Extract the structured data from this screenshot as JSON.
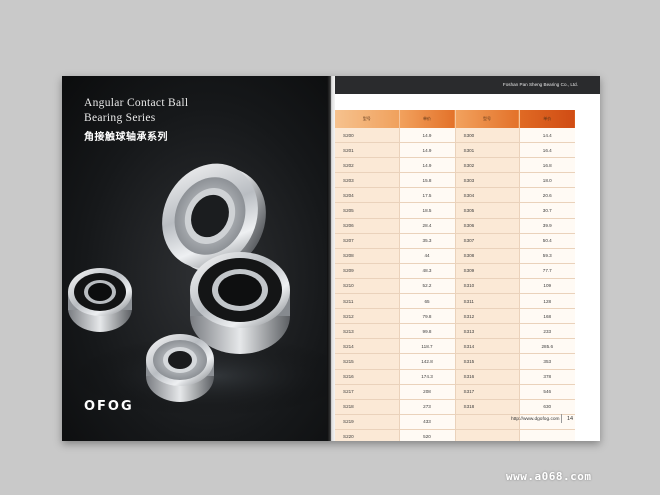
{
  "left_page": {
    "title_en": "Angular Contact Ball\nBearing Series",
    "title_cn": "角接触球轴承系列",
    "logo_text": "OFOG"
  },
  "right_page": {
    "company": "Foshan Pan Sheng Bearing Co., Ltd.",
    "table_headers": [
      "型号",
      "单价",
      "型号",
      "单价"
    ],
    "rows": [
      [
        "S200",
        "14.9",
        "S300",
        "14.4"
      ],
      [
        "S201",
        "14.9",
        "S301",
        "16.4"
      ],
      [
        "S202",
        "14.9",
        "S302",
        "16.8"
      ],
      [
        "S203",
        "15.8",
        "S303",
        "18.0"
      ],
      [
        "S204",
        "17.5",
        "S304",
        "20.6"
      ],
      [
        "S205",
        "18.5",
        "S305",
        "30.7"
      ],
      [
        "S206",
        "28.4",
        "S306",
        "39.9"
      ],
      [
        "S207",
        "35.3",
        "S307",
        "50.4"
      ],
      [
        "S208",
        "44",
        "S308",
        "59.3"
      ],
      [
        "S209",
        "48.3",
        "S309",
        "77.7"
      ],
      [
        "S210",
        "52.2",
        "S310",
        "109"
      ],
      [
        "S211",
        "65",
        "S311",
        "128"
      ],
      [
        "S212",
        "79.8",
        "S312",
        "168"
      ],
      [
        "S213",
        "99.8",
        "S313",
        "233"
      ],
      [
        "S214",
        "118.7",
        "S314",
        "285.6"
      ],
      [
        "S215",
        "142.8",
        "S315",
        "353"
      ],
      [
        "S216",
        "174.3",
        "S316",
        "378"
      ],
      [
        "S217",
        "208",
        "S317",
        "546"
      ],
      [
        "S218",
        "273",
        "S318",
        "630"
      ],
      [
        "S219",
        "433",
        "",
        ""
      ],
      [
        "S220",
        "520",
        "",
        ""
      ]
    ],
    "footer_url": "http://www.dgofog.com",
    "page_number": "14"
  },
  "watermark": "www.a068.com",
  "colors": {
    "header_orange": "#e3722a",
    "code_cell": "#fbe9d6",
    "dark_page": "#16181a"
  }
}
